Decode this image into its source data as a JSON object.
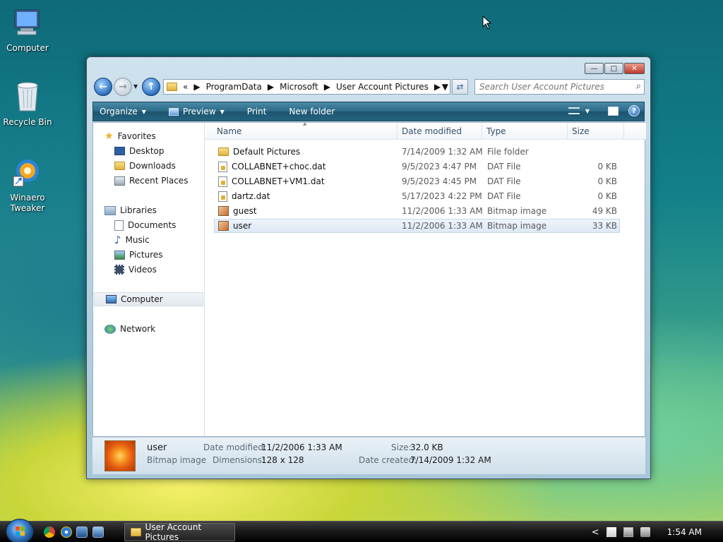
{
  "desktop": {
    "icons": [
      {
        "label": "Computer"
      },
      {
        "label": "Recycle Bin"
      },
      {
        "label": "Winaero\nTweaker"
      }
    ]
  },
  "window": {
    "title_buttons": {
      "minimize": "—",
      "maximize": "□",
      "close": "✕"
    },
    "address": {
      "prefix": "«",
      "crumbs": [
        "ProgramData",
        "Microsoft",
        "User Account Pictures"
      ]
    },
    "search": {
      "placeholder": "Search User Account Pictures"
    },
    "toolbar": {
      "organize": "Organize",
      "preview": "Preview",
      "print": "Print",
      "new_folder": "New folder"
    },
    "nav": {
      "favorites": "Favorites",
      "desktop": "Desktop",
      "downloads": "Downloads",
      "recent_places": "Recent Places",
      "libraries": "Libraries",
      "documents": "Documents",
      "music": "Music",
      "pictures": "Pictures",
      "videos": "Videos",
      "computer": "Computer",
      "network": "Network"
    },
    "columns": {
      "name": "Name",
      "date_modified": "Date modified",
      "type": "Type",
      "size": "Size"
    },
    "files": [
      {
        "name": "Default Pictures",
        "date": "7/14/2009 1:32 AM",
        "type": "File folder",
        "size": "",
        "icon": "folder"
      },
      {
        "name": "COLLABNET+choc.dat",
        "date": "9/5/2023 4:47 PM",
        "type": "DAT File",
        "size": "0 KB",
        "icon": "dat"
      },
      {
        "name": "COLLABNET+VM1.dat",
        "date": "9/5/2023 4:45 PM",
        "type": "DAT File",
        "size": "0 KB",
        "icon": "dat"
      },
      {
        "name": "dartz.dat",
        "date": "5/17/2023 4:22 PM",
        "type": "DAT File",
        "size": "0 KB",
        "icon": "dat"
      },
      {
        "name": "guest",
        "date": "11/2/2006 1:33 AM",
        "type": "Bitmap image",
        "size": "49 KB",
        "icon": "bitmap"
      },
      {
        "name": "user",
        "date": "11/2/2006 1:33 AM",
        "type": "Bitmap image",
        "size": "33 KB",
        "icon": "bitmap"
      }
    ],
    "details": {
      "name": "user",
      "type": "Bitmap image",
      "date_modified_label": "Date modified:",
      "date_modified": "11/2/2006 1:33 AM",
      "dimensions_label": "Dimensions:",
      "dimensions": "128 x 128",
      "size_label": "Size:",
      "size": "32.0 KB",
      "date_created_label": "Date created:",
      "date_created": "7/14/2009 1:32 AM"
    }
  },
  "taskbar": {
    "task_label": "User Account Pictures",
    "tray_chevron": "<",
    "clock": "1:54 AM"
  }
}
